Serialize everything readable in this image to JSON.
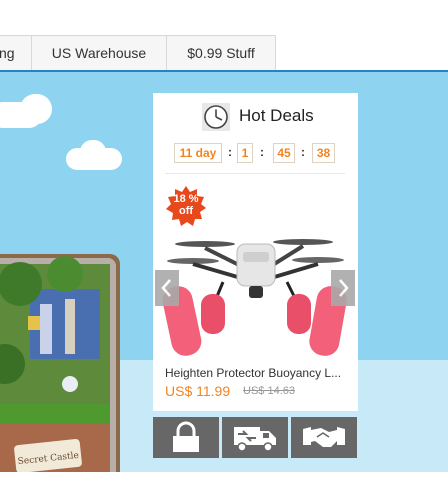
{
  "nav": {
    "tabs": [
      {
        "label": "ng"
      },
      {
        "label": "US Warehouse"
      },
      {
        "label": "$0.99 Stuff"
      }
    ]
  },
  "deals": {
    "title": "Hot Deals",
    "timer": {
      "days": "11 day",
      "hours": "1",
      "minutes": "45",
      "seconds": "38",
      "separator": ":"
    },
    "discount_badge": {
      "line1": "18 %",
      "line2": "off"
    },
    "product": {
      "name": "Heighten Protector Buoyancy L...",
      "price": "US$ 11.99",
      "old_price": "US$ 14.63"
    }
  },
  "icons": [
    "clock-icon",
    "lock-icon",
    "delivery-truck-icon",
    "handshake-icon",
    "chevron-left-icon",
    "chevron-right-icon"
  ],
  "colors": {
    "accent_orange": "#f2841f",
    "nav_underline": "#2b7fc2",
    "sky": "#8ed3f0",
    "icon_bar": "#676767"
  }
}
